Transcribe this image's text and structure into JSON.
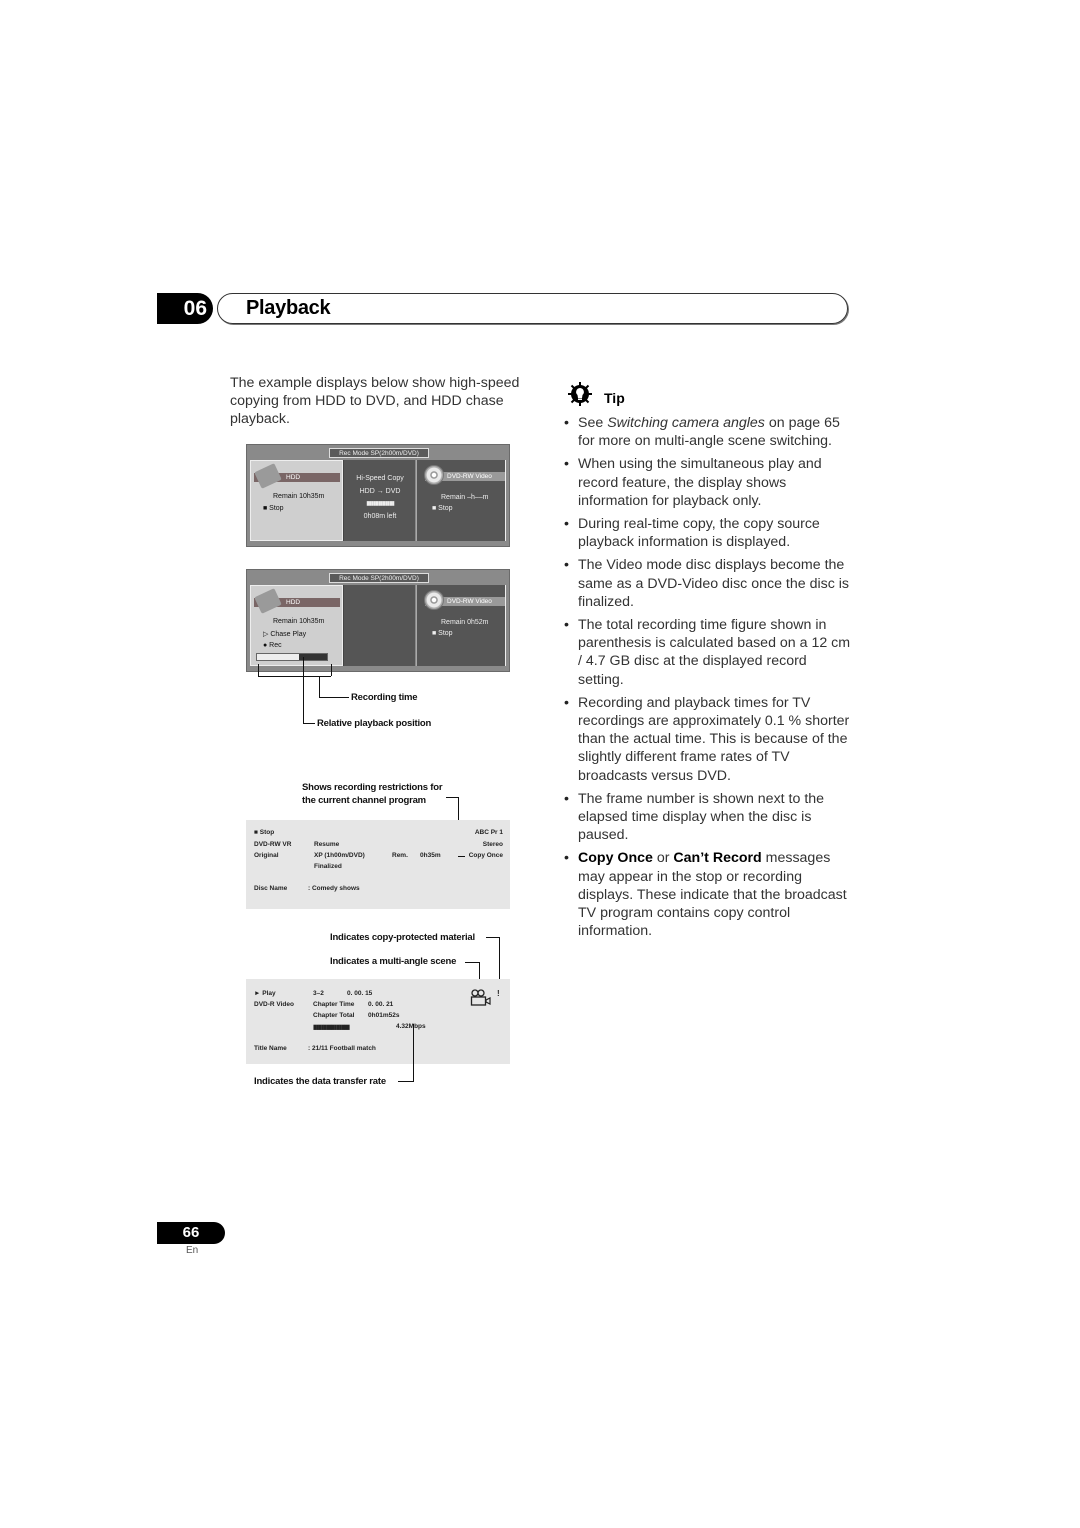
{
  "header": {
    "chapter_number": "06",
    "chapter_title": "Playback"
  },
  "intro": "The example displays below show high-speed copying from HDD to DVD, and HDD chase playback.",
  "osd1": {
    "rec_mode": "Rec Mode   SP(2h00m/DVD)",
    "hdd": {
      "label": "HDD",
      "remain": "Remain  10h35m",
      "status": "■ Stop"
    },
    "middle": {
      "line1": "Hi-Speed Copy",
      "line2": "HDD → DVD",
      "bar": "▮▮▮▮▮▮▮▮▮▮▮▮",
      "time_left": "0h08m left"
    },
    "dvd": {
      "label": "DVD-RW Video",
      "remain": "Remain  –h––m",
      "status": "■ Stop"
    }
  },
  "osd2": {
    "rec_mode": "Rec Mode   SP(2h00m/DVD)",
    "hdd": {
      "label": "HDD",
      "remain": "Remain  10h35m",
      "status1": "▷ Chase Play",
      "status2": "● Rec",
      "playback_position_fraction": 0.6
    },
    "dvd": {
      "label": "DVD-RW Video",
      "remain": "Remain  0h52m",
      "status": "■ Stop"
    },
    "callouts": {
      "recording_time": "Recording time",
      "relative_position": "Relative playback position"
    }
  },
  "panel1": {
    "callout": [
      "Shows recording restrictions for",
      "the current channel program"
    ],
    "status": "■ Stop",
    "disc_type": "DVD-RW   VR",
    "original": "Original",
    "resume": "Resume",
    "mode": "XP (1h00m/DVD)",
    "finalized": "Finalized",
    "rem_label": "Rem.",
    "rem_value": "0h35m",
    "channel": "ABC  Pr 1",
    "audio": "Stereo",
    "copy": "Copy Once",
    "disc_name_label": "Disc Name",
    "disc_name_value": ":  Comedy shows"
  },
  "panel2": {
    "callout_copy": "Indicates copy-protected material",
    "callout_angle": "Indicates a multi-angle scene",
    "callout_rate": "Indicates the data transfer rate",
    "status": "► Play",
    "disc_type": "DVD-R   Video",
    "chapter": "3–2",
    "elapsed": "0. 00. 15",
    "chapter_time_label": "Chapter Time",
    "chapter_time_value": "0. 00. 21",
    "chapter_total_label": "Chapter Total",
    "chapter_total_value": "0h01m52s",
    "bar": "▮▮▮▮▮▮▮▮▮▮▮▮▮▮",
    "rate": "4.32Mbps",
    "exclaim": "!",
    "title_name_label": "Title Name",
    "title_name_value": ":  21/11 Football match"
  },
  "tip": {
    "heading": "Tip",
    "items": [
      {
        "pre": "See ",
        "em": "Switching camera angles",
        "post": " on page 65 for more on multi-angle scene switching."
      },
      {
        "text": "When using the simultaneous play and record feature, the display shows information for playback only."
      },
      {
        "text": "During real-time copy, the copy source playback information is displayed."
      },
      {
        "text": "The Video mode disc displays become the same as a DVD-Video disc once the disc is finalized."
      },
      {
        "text": "The total recording time figure shown in parenthesis is calculated based on a 12 cm / 4.7 GB disc at the displayed record setting."
      },
      {
        "text": "Recording and playback times for TV recordings are approximately 0.1 % shorter than the actual time. This is because of the slightly different frame rates of TV broadcasts versus DVD."
      },
      {
        "text": "The frame number is shown next to the elapsed time display when the disc is paused."
      },
      {
        "b1": "Copy Once",
        "mid": " or ",
        "b2": "Can’t Record",
        "post": " messages may appear in the stop or recording displays. These indicate that the broadcast TV program contains copy control information."
      }
    ]
  },
  "footer": {
    "page_number": "66",
    "language": "En"
  }
}
